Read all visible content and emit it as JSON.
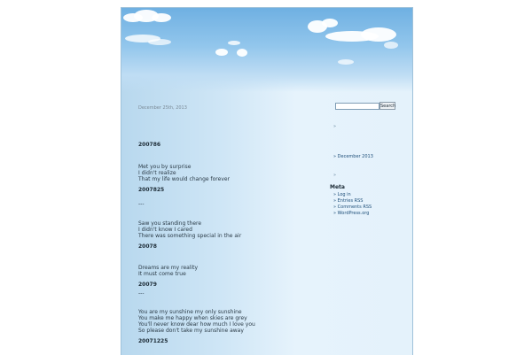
{
  "post": {
    "date": "December 25th, 2013",
    "entries": [
      {
        "title": "200786",
        "lines": [
          "Met you by surprise",
          "I didn't realize",
          "That my life would change forever"
        ]
      },
      {
        "title": "2007825",
        "lines": [
          "Saw you standing there",
          "I didn't know I cared",
          "There was something special in the air"
        ]
      },
      {
        "title": "20078",
        "lines": [
          "Dreams are my reality",
          "It must come true"
        ]
      },
      {
        "title": "20079",
        "lines": [
          "You are my sunshine my only sunshine",
          "You make me happy when skies are grey",
          "You'll never know dear how much I love you",
          "So please don't take my sunshine away"
        ]
      },
      {
        "title": "20071225",
        "lines": []
      }
    ],
    "separator": "---"
  },
  "sidebar": {
    "search_button": "Search",
    "search_placeholder": "",
    "bullet_1": "»",
    "archives": [
      "» December 2013"
    ],
    "bullet_2": "»",
    "meta_heading": "Meta",
    "meta_links": [
      "» Log in",
      "» Entries RSS",
      "» Comments RSS",
      "» WordPress.org"
    ]
  }
}
